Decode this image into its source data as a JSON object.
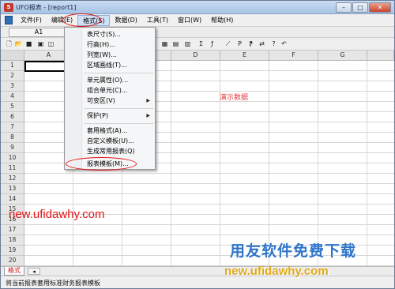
{
  "window": {
    "title": "UFO报表 - [report1]"
  },
  "menubar": {
    "items": [
      "文件(F)",
      "编辑(E)",
      "格式(S)",
      "数据(D)",
      "工具(T)",
      "窗口(W)",
      "帮助(H)"
    ],
    "active_index": 2
  },
  "formulabar": {
    "cell_ref": "A1"
  },
  "toolbar": {
    "icons": [
      "new-icon",
      "open-icon",
      "save-icon",
      "print-icon",
      "preview-icon",
      "sum-icon",
      "chart-icon",
      "format-icon",
      "help-icon",
      "undo-icon"
    ]
  },
  "grid": {
    "columns": [
      "A",
      "B",
      "C",
      "D",
      "E",
      "F",
      "G"
    ],
    "rows": [
      "1",
      "2",
      "3",
      "4",
      "5",
      "6",
      "7",
      "8",
      "9",
      "10",
      "11",
      "12",
      "13",
      "14",
      "15",
      "16",
      "17",
      "18",
      "19",
      "20"
    ],
    "demo_text": "演示数据"
  },
  "format_menu": {
    "items": [
      "表尺寸(S)...",
      "行高(H)...",
      "列宽(W)...",
      "区域画线(T)...",
      "单元属性(O)...",
      "组合单元(C)...",
      "可变区(V)",
      "保护(P)",
      "套用格式(A)...",
      "自定义模板(U)...",
      "生成常用报表(Q)",
      "报表模板(M)..."
    ],
    "has_submenu": [
      6,
      7
    ],
    "highlighted": "报表模板(M)..."
  },
  "sheetbar": {
    "tab_label": "格式"
  },
  "statusbar": {
    "text": "将当前报表套用标准财务报表模板"
  },
  "watermarks": {
    "url_red": "new.ufidawhy.com",
    "brand": "用友软件免费下载",
    "url_gold": "new.ufidawhy.com"
  },
  "colors": {
    "annotation_red": "#e01515",
    "brand_blue": "#2e74c9",
    "brand_gold": "#e0a91a"
  }
}
